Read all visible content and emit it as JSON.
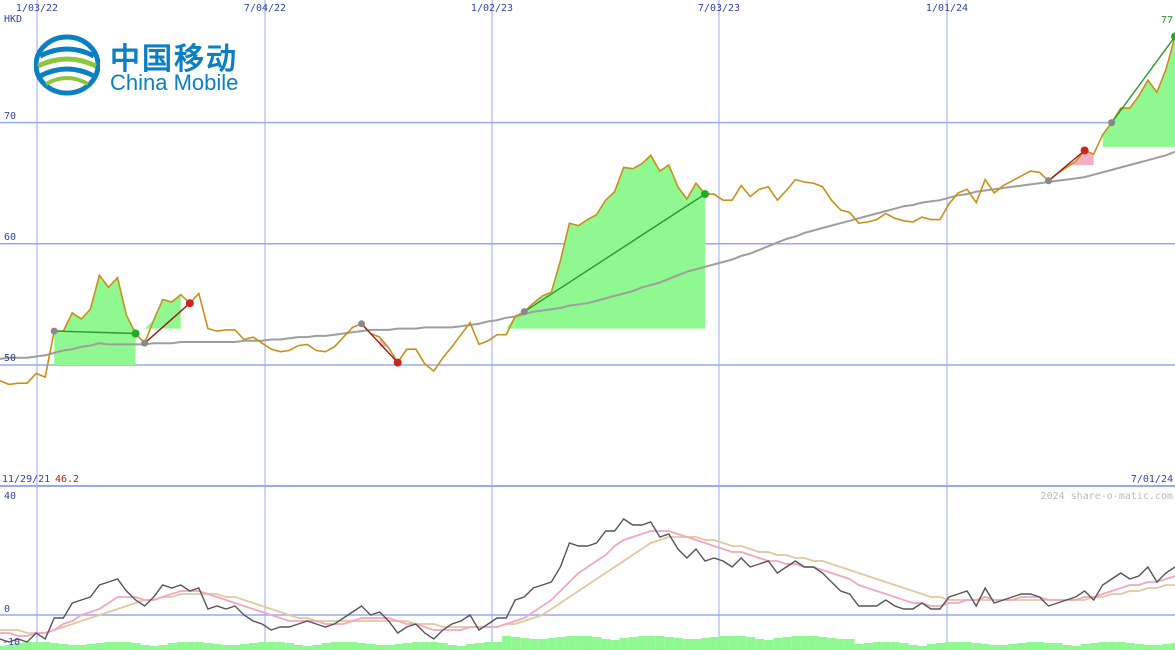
{
  "logo": {
    "name_cn": "中国移动",
    "name_en": "China Mobile"
  },
  "colors": {
    "price_line": "#c8901a",
    "moving_average": "#9e9e9e",
    "gain_fill": "#90f890",
    "loss_fill": "#f4b0c0",
    "grid": "#9aa8f0",
    "axis_text": "#3344aa",
    "macd_line": "#555555",
    "macd_signal": "#f0a8c0",
    "macd_slow": "#e0c8a0",
    "volume_bars": "#90f890"
  },
  "chart_data": [
    {
      "type": "line",
      "unit_label": "HKD",
      "x_tick_labels": [
        "1/03/22",
        "7/04/22",
        "1/02/23",
        "7/03/23",
        "1/01/24"
      ],
      "y_tick_labels": [
        "50",
        "60",
        "70"
      ],
      "ylim": [
        47,
        78
      ],
      "last_value_label": "77",
      "grid": true,
      "series": [
        {
          "values": [
            48.7,
            48.4,
            48.5,
            48.5,
            49.3,
            49.0,
            52.8,
            52.8,
            54.3,
            53.8,
            54.6,
            57.4,
            56.4,
            57.2,
            54.1,
            52.6,
            51.8,
            53.7,
            55.4,
            55.2,
            55.8,
            55.1,
            55.9,
            53.0,
            52.8,
            52.9,
            52.9,
            52.1,
            52.3,
            51.8,
            51.3,
            51.1,
            51.2,
            51.6,
            51.7,
            51.2,
            51.1,
            51.5,
            52.3,
            53.1,
            53.4,
            52.6,
            52.3,
            51.4,
            50.2,
            51.3,
            51.3,
            50.1,
            49.5,
            50.6,
            51.5,
            52.5,
            53.5,
            51.7,
            52.0,
            52.5,
            52.5,
            54.0,
            54.4,
            55.1,
            55.7,
            56.0,
            58.6,
            61.7,
            61.5,
            62.0,
            62.4,
            63.6,
            64.3,
            66.3,
            66.2,
            66.6,
            67.3,
            66.0,
            66.5,
            64.7,
            63.7,
            65.0,
            64.1,
            64.1,
            63.6,
            63.6,
            64.8,
            63.9,
            64.5,
            64.7,
            63.6,
            64.4,
            65.3,
            65.1,
            65.0,
            64.7,
            63.6,
            62.8,
            62.6,
            61.7,
            61.8,
            62.0,
            62.5,
            62.1,
            61.9,
            61.8,
            62.2,
            62.0,
            62.0,
            63.3,
            64.2,
            64.5,
            63.4,
            65.3,
            64.2,
            64.8,
            65.2,
            65.6,
            66.0,
            65.9,
            65.2,
            65.8,
            66.3,
            66.8,
            67.7,
            67.4,
            69.0,
            70.0,
            71.2,
            71.2,
            72.2,
            73.5,
            72.5,
            74.4,
            77.1
          ],
          "x_start": "2021-11-29",
          "x_end": "2024-07-01"
        },
        {
          "values": [
            50.5,
            50.6,
            50.6,
            50.6,
            50.7,
            50.8,
            51.0,
            51.2,
            51.3,
            51.5,
            51.6,
            51.8,
            51.7,
            51.7,
            51.7,
            51.7,
            51.7,
            51.8,
            51.8,
            51.8,
            51.9,
            51.9,
            51.9,
            51.9,
            51.9,
            51.9,
            51.9,
            52.0,
            52.0,
            52.0,
            52.1,
            52.1,
            52.2,
            52.3,
            52.3,
            52.4,
            52.4,
            52.5,
            52.6,
            52.7,
            52.8,
            52.9,
            52.9,
            52.9,
            53.0,
            53.0,
            53.0,
            53.1,
            53.1,
            53.1,
            53.1,
            53.2,
            53.3,
            53.4,
            53.6,
            53.7,
            53.9,
            54.0,
            54.2,
            54.4,
            54.5,
            54.6,
            54.7,
            54.9,
            55.0,
            55.1,
            55.3,
            55.5,
            55.7,
            55.9,
            56.1,
            56.4,
            56.6,
            56.8,
            57.1,
            57.4,
            57.7,
            57.9,
            58.1,
            58.3,
            58.5,
            58.7,
            59.0,
            59.2,
            59.5,
            59.8,
            60.1,
            60.4,
            60.6,
            60.9,
            61.1,
            61.3,
            61.5,
            61.7,
            61.9,
            62.1,
            62.3,
            62.5,
            62.7,
            62.9,
            63.1,
            63.2,
            63.4,
            63.5,
            63.6,
            63.8,
            64.0,
            64.1,
            64.3,
            64.4,
            64.5,
            64.6,
            64.7,
            64.8,
            64.9,
            65.0,
            65.1,
            65.2,
            65.3,
            65.4,
            65.5,
            65.7,
            65.9,
            66.1,
            66.3,
            66.5,
            66.7,
            66.9,
            67.1,
            67.3,
            67.6
          ]
        }
      ]
    },
    {
      "type": "line",
      "date_start_label": "11/29/21",
      "date_end_label": "7/01/24",
      "indicator_value_label": "46.2",
      "watermark": "2024 share-o-matic.com",
      "y_tick_labels": [
        "40",
        "0",
        "-10"
      ],
      "ylim": [
        -13,
        43
      ],
      "series": [
        {
          "values": [
            -8,
            -9,
            -8,
            -9,
            -6,
            -8,
            -1,
            -1,
            4,
            5,
            6,
            10,
            11,
            12,
            8,
            5,
            3,
            6,
            10,
            9,
            10,
            8,
            9,
            2,
            3,
            2,
            3,
            0,
            -2,
            -3,
            -5,
            -4,
            -4,
            -3,
            -2,
            -3,
            -4,
            -3,
            -1,
            1,
            3,
            0,
            1,
            -2,
            -6,
            -4,
            -3,
            -6,
            -8,
            -5,
            -3,
            -2,
            0,
            -5,
            -3,
            -1,
            -1,
            5,
            6,
            9,
            10,
            11,
            16,
            24,
            23,
            23,
            24,
            28,
            28,
            32,
            30,
            30,
            31,
            26,
            27,
            22,
            19,
            22,
            18,
            19,
            18,
            16,
            19,
            16,
            17,
            18,
            14,
            16,
            18,
            16,
            16,
            14,
            11,
            8,
            7,
            3,
            3,
            3,
            5,
            3,
            2,
            2,
            4,
            2,
            2,
            6,
            7,
            8,
            3,
            9,
            4,
            5,
            6,
            7,
            7,
            6,
            3,
            4,
            5,
            6,
            8,
            5,
            10,
            12,
            14,
            12,
            13,
            16,
            11,
            14,
            16
          ]
        },
        {
          "values": [
            -6,
            -6,
            -7,
            -7,
            -6,
            -6,
            -5,
            -3,
            -2,
            0,
            1,
            2,
            4,
            6,
            6,
            6,
            5,
            5,
            6,
            7,
            8,
            8,
            8,
            7,
            6,
            5,
            4,
            3,
            2,
            1,
            0,
            -1,
            -2,
            -2,
            -2,
            -2,
            -3,
            -3,
            -3,
            -2,
            -1,
            -1,
            -1,
            -1,
            -2,
            -3,
            -3,
            -4,
            -5,
            -5,
            -5,
            -5,
            -4,
            -4,
            -4,
            -4,
            -3,
            -2,
            -1,
            1,
            3,
            5,
            8,
            11,
            14,
            16,
            18,
            20,
            23,
            25,
            26,
            27,
            28,
            28,
            28,
            27,
            26,
            25,
            24,
            23,
            22,
            21,
            21,
            20,
            19,
            18,
            18,
            17,
            17,
            16,
            16,
            15,
            14,
            13,
            12,
            10,
            9,
            8,
            7,
            6,
            5,
            4,
            4,
            3,
            3,
            4,
            4,
            5,
            5,
            6,
            5,
            5,
            5,
            6,
            6,
            6,
            5,
            5,
            5,
            5,
            6,
            6,
            7,
            8,
            9,
            10,
            10,
            11,
            11,
            12,
            13
          ]
        },
        {
          "values": [
            -5,
            -5,
            -5,
            -6,
            -6,
            -6,
            -5,
            -4,
            -3,
            -2,
            -1,
            0,
            1,
            2,
            3,
            4,
            5,
            5,
            6,
            6,
            7,
            7,
            7,
            7,
            7,
            6,
            6,
            5,
            4,
            3,
            2,
            1,
            0,
            -1,
            -1,
            -2,
            -2,
            -2,
            -2,
            -2,
            -2,
            -2,
            -2,
            -2,
            -2,
            -2,
            -3,
            -3,
            -3,
            -4,
            -4,
            -4,
            -4,
            -4,
            -4,
            -4,
            -3,
            -3,
            -2,
            -1,
            0,
            2,
            4,
            6,
            8,
            10,
            12,
            14,
            16,
            18,
            20,
            22,
            24,
            25,
            26,
            26,
            26,
            26,
            25,
            25,
            24,
            23,
            23,
            22,
            21,
            21,
            20,
            20,
            19,
            19,
            18,
            18,
            17,
            16,
            15,
            14,
            13,
            12,
            11,
            10,
            9,
            8,
            7,
            6,
            6,
            5,
            5,
            5,
            5,
            5,
            5,
            5,
            5,
            5,
            5,
            5,
            5,
            5,
            5,
            5,
            5,
            6,
            6,
            7,
            7,
            8,
            8,
            9,
            9,
            10,
            10
          ]
        }
      ]
    }
  ]
}
